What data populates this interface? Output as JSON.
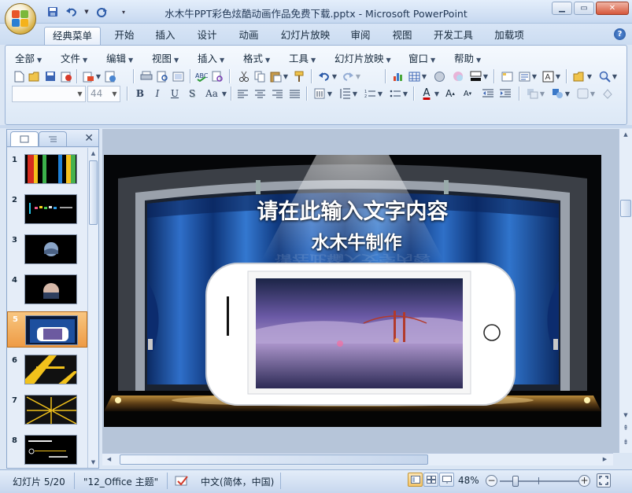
{
  "window": {
    "title": "水木牛PPT彩色炫酷动画作品免费下载.pptx - Microsoft PowerPoint"
  },
  "ribbon_tabs": [
    "经典菜单",
    "开始",
    "插入",
    "设计",
    "动画",
    "幻灯片放映",
    "审阅",
    "视图",
    "开发工具",
    "加载项"
  ],
  "active_tab": "经典菜单",
  "menus": [
    "全部",
    "文件",
    "编辑",
    "视图",
    "插入",
    "格式",
    "工具",
    "幻灯片放映",
    "窗口",
    "帮助"
  ],
  "font_size_value": "44",
  "format_buttons": {
    "bold": "B",
    "italic": "I",
    "underline": "U",
    "shadow": "S",
    "case": "Aa"
  },
  "text_color_letter": "A",
  "slide": {
    "title": "请在此输入文字内容",
    "subtitle": "水木牛制作"
  },
  "thumbnails": [
    {
      "num": "1"
    },
    {
      "num": "2"
    },
    {
      "num": "3"
    },
    {
      "num": "4"
    },
    {
      "num": "5",
      "selected": true
    },
    {
      "num": "6"
    },
    {
      "num": "7"
    },
    {
      "num": "8"
    }
  ],
  "status": {
    "slide_info": "幻灯片 5/20",
    "theme": "\"12_Office 主题\"",
    "language": "中文(简体，中国)",
    "zoom": "48%"
  },
  "colors": {
    "accent": "#f6c66a",
    "ribbon_blue": "#c9daf0",
    "curtain": "#1d4f9e"
  }
}
